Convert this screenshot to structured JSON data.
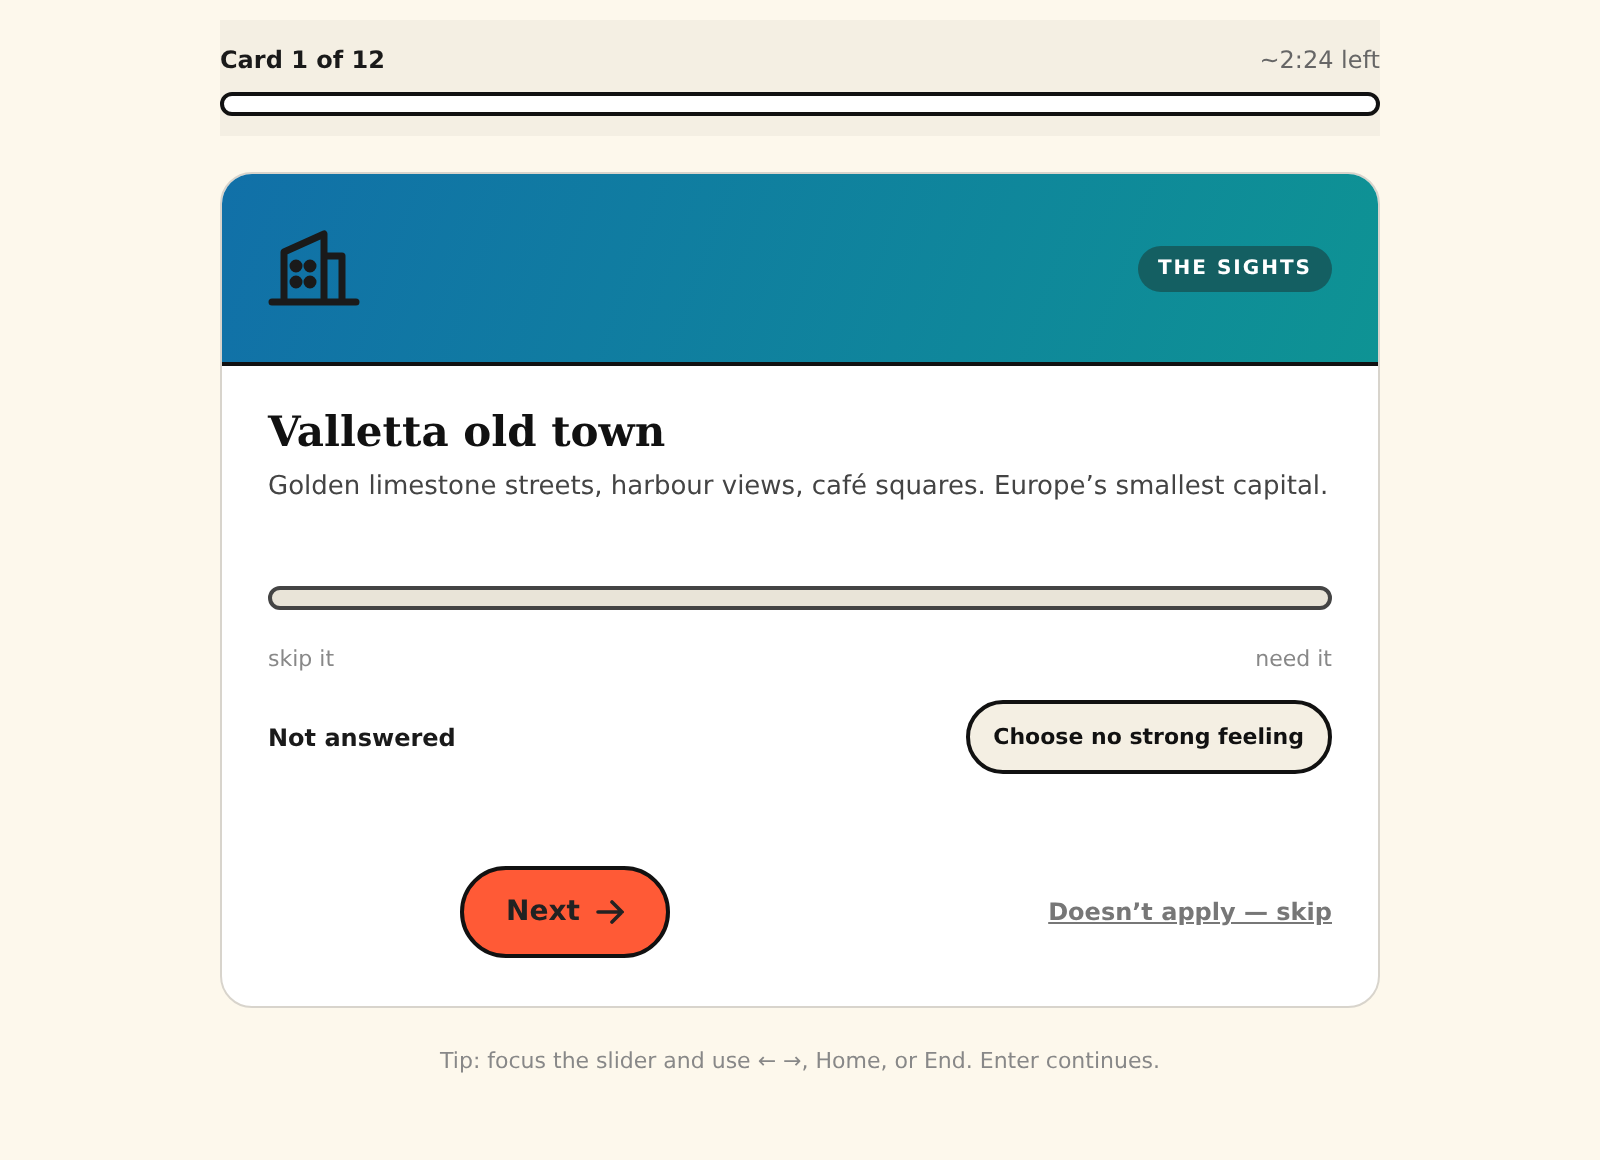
{
  "progress": {
    "label": "Card 1 of 12",
    "time_left": "~2:24 left",
    "level": 0
  },
  "card": {
    "category": "THE SIGHTS",
    "title": "Valletta old town",
    "description": "Golden limestone streets, harbour views, café squares. Europe’s smallest capital.",
    "slider": {
      "min_label": "skip it",
      "max_label": "need it"
    },
    "status": "Not answered",
    "neutral_button": "Choose no strong feeling",
    "next_button": "Next",
    "skip_link": "Doesn’t apply — skip"
  },
  "tip": "Tip: focus the slider and use ← →, Home, or End. Enter continues."
}
